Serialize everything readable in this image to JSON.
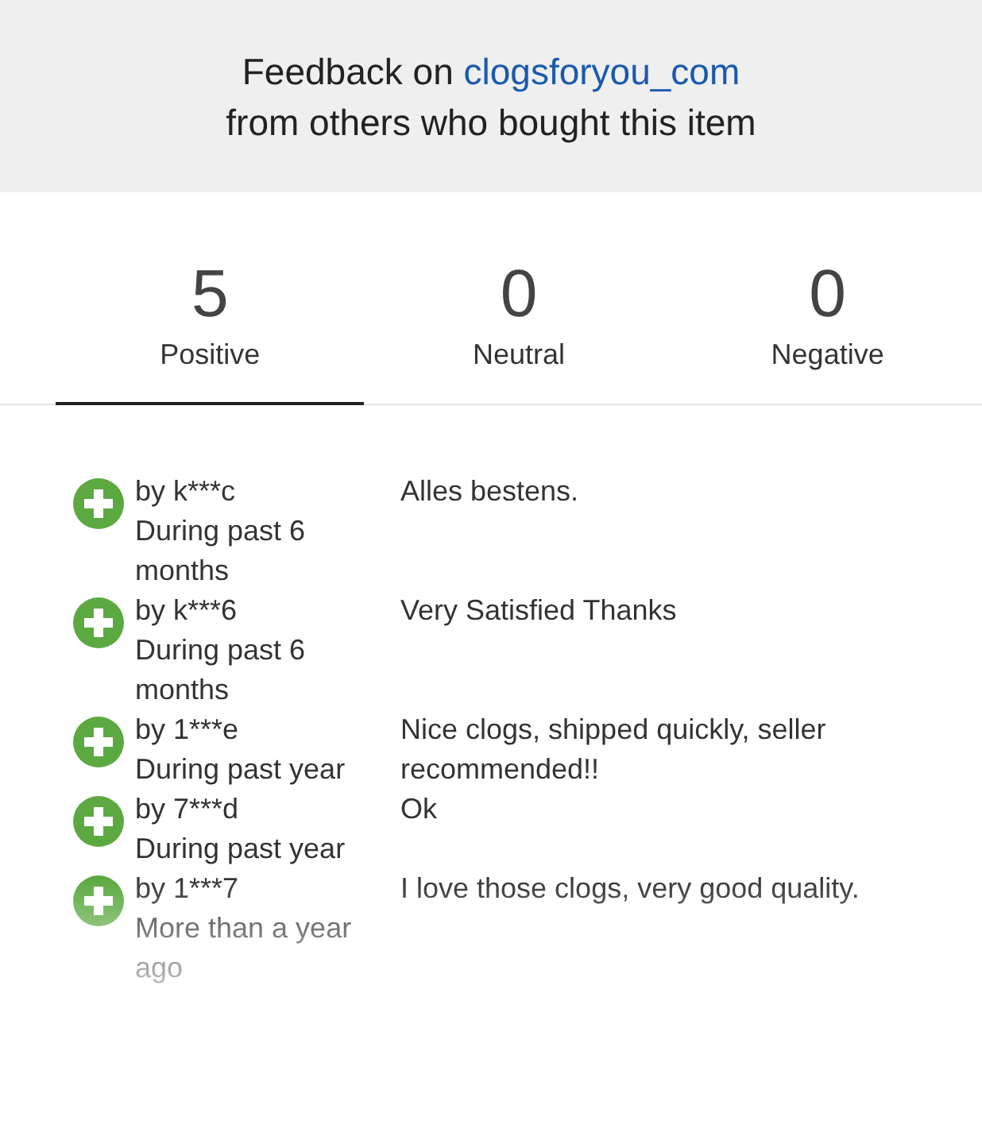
{
  "header": {
    "title_prefix": "Feedback on ",
    "seller": "clogsforyou_com",
    "subtitle": "from others who bought this item"
  },
  "tabs": [
    {
      "count": "5",
      "label": "Positive",
      "selected": true
    },
    {
      "count": "0",
      "label": "Neutral",
      "selected": false
    },
    {
      "count": "0",
      "label": "Negative",
      "selected": false
    }
  ],
  "feedback": [
    {
      "kind": "positive",
      "user": "by k***c",
      "when": "During past 6 months",
      "comment": "Alles bestens."
    },
    {
      "kind": "positive",
      "user": "by k***6",
      "when": "During past 6 months",
      "comment": "Very Satisfied Thanks"
    },
    {
      "kind": "positive",
      "user": "by 1***e",
      "when": "During past year",
      "comment": "Nice clogs, shipped quickly, seller recommended!!"
    },
    {
      "kind": "positive",
      "user": "by 7***d",
      "when": "During past year",
      "comment": "Ok"
    },
    {
      "kind": "positive",
      "user": "by 1***7",
      "when": "More than a year ago",
      "comment": "I love those clogs, very good quality."
    }
  ]
}
